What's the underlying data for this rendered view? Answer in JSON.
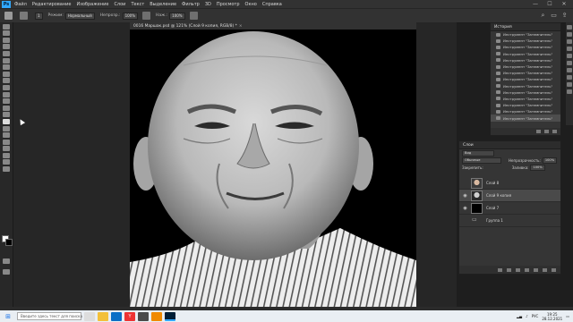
{
  "app": {
    "logo": "Ps"
  },
  "menu": [
    "Файл",
    "Редактирование",
    "Изображение",
    "Слои",
    "Текст",
    "Выделение",
    "Фильтр",
    "3D",
    "Просмотр",
    "Окно",
    "Справка"
  ],
  "window_controls": [
    "—",
    "☐",
    "✕"
  ],
  "options": {
    "size": "1",
    "mode_label": "Режим:",
    "mode_value": "Нормальный",
    "opacity_label": "Непрозр.:",
    "opacity_value": "100%",
    "flow_label": "Наж.:",
    "flow_value": "100%"
  },
  "document": {
    "tab_title": "0016 Маршак.psd @ 121% (Слой 9 копия, RGB/8) *",
    "close": "×"
  },
  "history": {
    "title": "История",
    "items": [
      "Инструмент \"Затемнитель\"",
      "Инструмент \"Затемнитель\"",
      "Инструмент \"Затемнитель\"",
      "Инструмент \"Затемнитель\"",
      "Инструмент \"Затемнитель\"",
      "Инструмент \"Затемнитель\"",
      "Инструмент \"Затемнитель\"",
      "Инструмент \"Затемнитель\"",
      "Инструмент \"Затемнитель\"",
      "Инструмент \"Затемнитель\"",
      "Инструмент \"Затемнитель\"",
      "Инструмент \"Затемнитель\"",
      "Инструмент \"Затемнитель\"",
      "Инструмент \"Затемнитель\""
    ],
    "selected_index": 13
  },
  "layers": {
    "title": "Слои",
    "filter": "Вид",
    "blend_mode": "Обычные",
    "opacity_label": "Непрозрачность:",
    "opacity_value": "100%",
    "lock_label": "Закрепить:",
    "fill_label": "Заливка:",
    "fill_value": "100%",
    "items": [
      {
        "name": "Слой 8",
        "visible": false,
        "thumb": "portrait"
      },
      {
        "name": "Слой 9 копия",
        "visible": true,
        "thumb": "portrait-gray",
        "selected": true
      },
      {
        "name": "Слой 7",
        "visible": true,
        "thumb": "black"
      },
      {
        "name": "Группа 1",
        "visible": false,
        "thumb": "folder"
      }
    ]
  },
  "taskbar": {
    "search_placeholder": "Введите здесь текст для поиска",
    "lang": "РУС",
    "time": "19:25",
    "date": "28.12.2021"
  },
  "colors": {
    "accent": "#31a8ff",
    "panel": "#353535",
    "bg": "#262626"
  }
}
